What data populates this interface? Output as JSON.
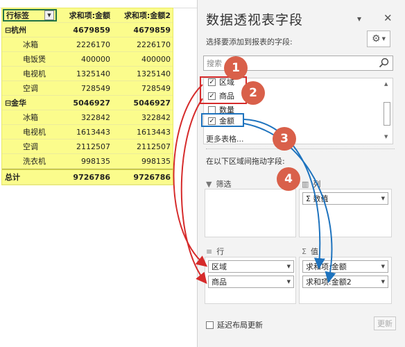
{
  "pivot": {
    "headers": [
      "行标签",
      "求和项:金额",
      "求和项:金额2"
    ],
    "groups": [
      {
        "name": "杭州",
        "v1": "4679859",
        "v2": "4679859",
        "items": [
          {
            "name": "冰箱",
            "v1": "2226170",
            "v2": "2226170"
          },
          {
            "name": "电饭煲",
            "v1": "400000",
            "v2": "400000"
          },
          {
            "name": "电视机",
            "v1": "1325140",
            "v2": "1325140"
          },
          {
            "name": "空调",
            "v1": "728549",
            "v2": "728549"
          }
        ]
      },
      {
        "name": "金华",
        "v1": "5046927",
        "v2": "5046927",
        "items": [
          {
            "name": "冰箱",
            "v1": "322842",
            "v2": "322842"
          },
          {
            "name": "电视机",
            "v1": "1613443",
            "v2": "1613443"
          },
          {
            "name": "空调",
            "v1": "2112507",
            "v2": "2112507"
          },
          {
            "name": "洗衣机",
            "v1": "998135",
            "v2": "998135"
          }
        ]
      }
    ],
    "total": {
      "label": "总计",
      "v1": "9726786",
      "v2": "9726786"
    }
  },
  "panel": {
    "title": "数据透视表字段",
    "subtitle": "选择要添加到报表的字段:",
    "search_placeholder": "搜索",
    "fields": [
      {
        "label": "区域",
        "checked": true
      },
      {
        "label": "商品",
        "checked": true
      },
      {
        "label": "数量",
        "checked": false
      },
      {
        "label": "金额",
        "checked": true
      }
    ],
    "more_tables": "更多表格...",
    "drag_label": "在以下区域间拖动字段:",
    "areas": {
      "filter": {
        "title": "筛选"
      },
      "columns": {
        "title": "列",
        "chips": [
          "数值"
        ]
      },
      "rows": {
        "title": "行",
        "chips": [
          "区域",
          "商品"
        ]
      },
      "values": {
        "title": "值",
        "chips": [
          "求和项:金额",
          "求和项:金额2"
        ]
      }
    },
    "defer_label": "延迟布局更新",
    "update_button": "更新"
  },
  "badges": [
    "1",
    "2",
    "3",
    "4"
  ],
  "colors": {
    "pivot_fill": "#fbfc8c",
    "badge": "#d9604a",
    "red_arrow": "#d62b2b",
    "blue_arrow": "#1e73be"
  }
}
